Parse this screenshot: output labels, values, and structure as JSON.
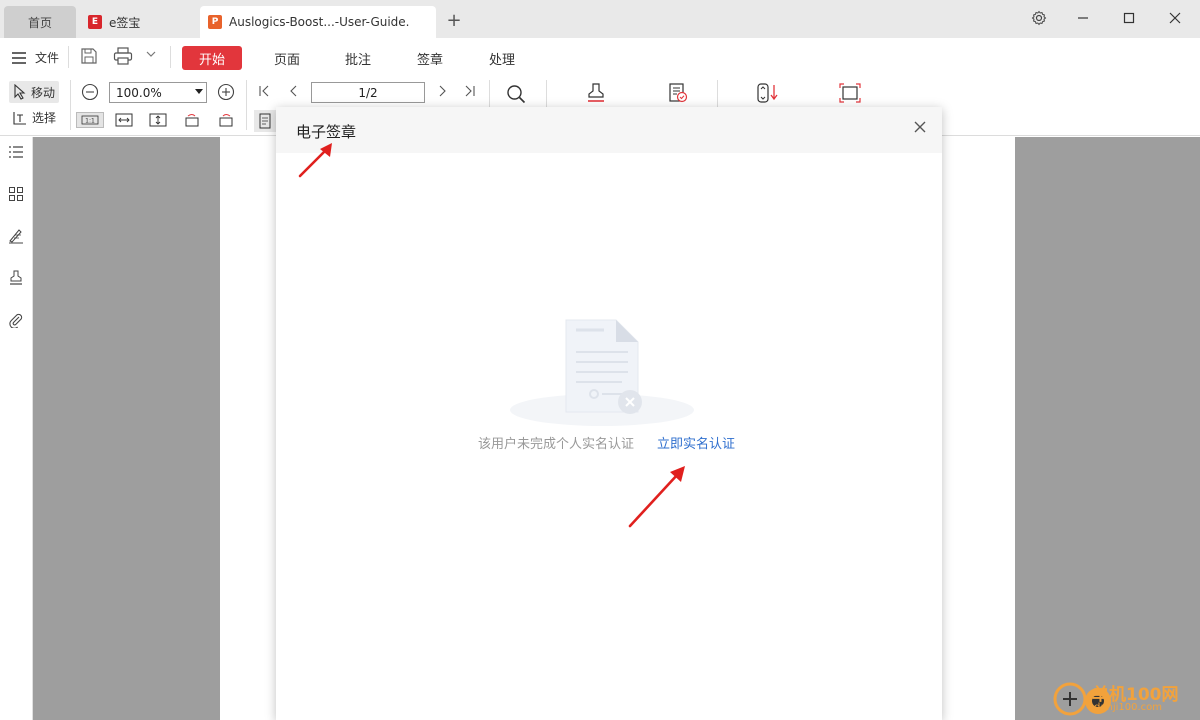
{
  "tabs": {
    "home": "首页",
    "esign": "e签宝",
    "document": "Auslogics-Boost...-User-Guide."
  },
  "menu": {
    "file": "文件",
    "items": [
      "开始",
      "页面",
      "批注",
      "签章",
      "处理"
    ]
  },
  "tools": {
    "move": "移动",
    "select": "选择",
    "zoom": "100.0%",
    "page": "1/2"
  },
  "dialog": {
    "title": "电子签章",
    "empty_message": "该用户未完成个人实名认证",
    "verify_link": "立即实名认证"
  },
  "watermark": {
    "name": "单机100网",
    "url": "danji100.com"
  },
  "colors": {
    "accent": "#e2363c",
    "link": "#2f6fce",
    "annotation_arrow": "#e0201e"
  }
}
